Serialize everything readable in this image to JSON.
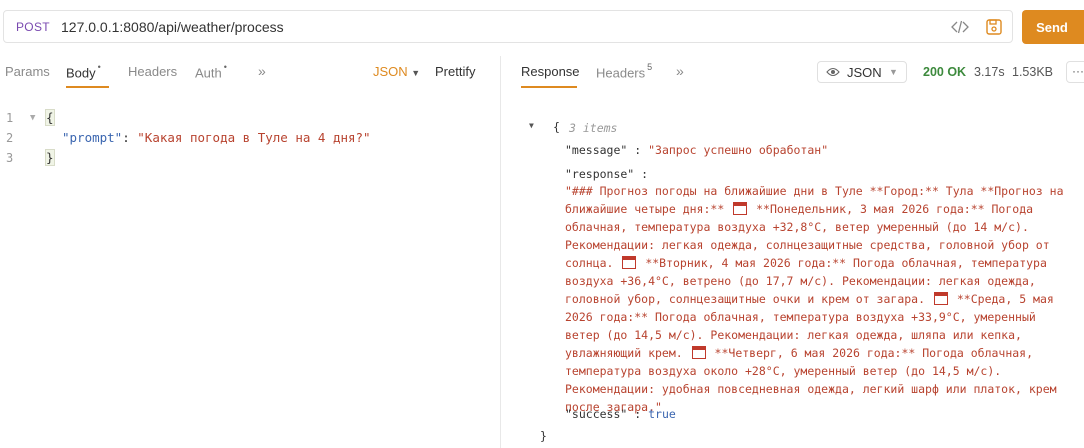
{
  "request": {
    "method": "POST",
    "url": "127.0.0.1:8080/api/weather/process",
    "send_label": "Send"
  },
  "request_tabs": {
    "params": "Params",
    "body": "Body",
    "body_dot": "•",
    "headers": "Headers",
    "auth": "Auth",
    "auth_dot": "•",
    "body_type": "JSON",
    "prettify": "Prettify"
  },
  "editor": {
    "line_numbers": [
      "1",
      "2",
      "3"
    ],
    "open_brace": "{",
    "key": "\"prompt\"",
    "colon": ": ",
    "value": "\"Какая погода в Туле на 4 дня?\"",
    "close_brace": "}"
  },
  "response_tabs": {
    "response": "Response",
    "headers": "Headers",
    "headers_count": "5",
    "view": "JSON",
    "status": "200 OK",
    "time": "3.17s",
    "size": "1.53KB",
    "more": "···"
  },
  "response_body": {
    "open": "{",
    "items_note": "3 items",
    "message_key": "\"message\"",
    "message_value": "\"Запрос успешно обработан\"",
    "response_key": "\"response\"",
    "response_parts": [
      "\"### Прогноз погоды на ближайшие дни в Туле **Город:** Тула **Прогноз на ближайшие четыре дня:** ",
      " **Понедельник, 3 мая 2026 года:** Погода облачная, температура воздуха +32,8°C, ветер умеренный (до 14 м/с). Рекомендации: легкая одежда, солнцезащитные средства, головной убор от солнца. ",
      " **Вторник, 4 мая 2026 года:** Погода облачная, температура воздуха +36,4°C, ветрено (до 17,7 м/с). Рекомендации: легкая одежда, головной убор, солнцезащитные очки и крем от загара. ",
      " **Среда, 5 мая 2026 года:** Погода облачная, температура воздуха +33,9°C, умеренный ветер (до 14,5 м/с). Рекомендации: легкая одежда, шляпа или кепка, увлажняющий крем. ",
      " **Четверг, 6 мая 2026 года:** Погода облачная, температура воздуха около +28°C, умеренный ветер (до 14,5 м/с). Рекомендации: удобная повседневная одежда, легкий шарф или платок, крем после загара.\""
    ],
    "success_key": "\"success\"",
    "success_value": "true",
    "close": "}"
  },
  "colors": {
    "accent": "#de8a20",
    "method": "#7a4ab0",
    "json_key": "#3b66b0",
    "json_string": "#b8432f",
    "status_ok": "#3d8a3d"
  }
}
